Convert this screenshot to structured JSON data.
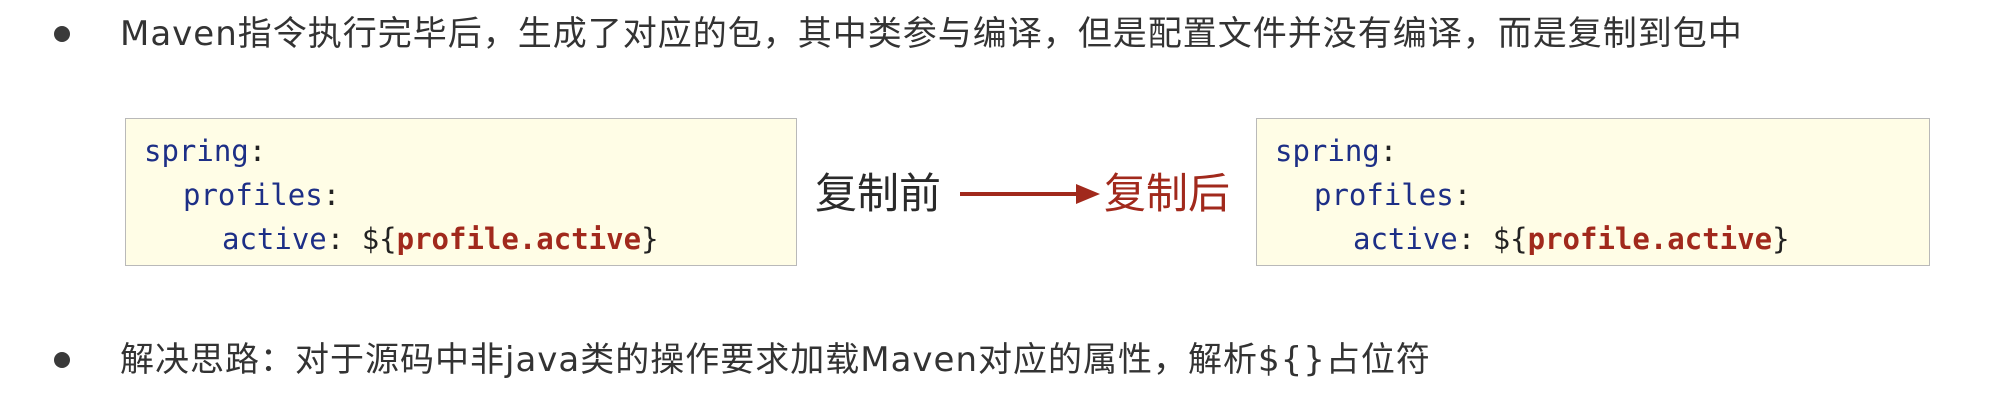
{
  "bullets": {
    "first": "Maven指令执行完毕后，生成了对应的包，其中类参与编译，但是配置文件并没有编译，而是复制到包中",
    "second": "解决思路：对于源码中非java类的操作要求加载Maven对应的属性，解析${}占位符"
  },
  "code_before": {
    "line1_key": "spring",
    "line2_key": "profiles",
    "line3_key": "active",
    "colon": ":",
    "placeholder_open": "${",
    "placeholder_name": "profile.active",
    "placeholder_close": "}"
  },
  "code_after": {
    "line1_key": "spring",
    "line2_key": "profiles",
    "line3_key": "active",
    "colon": ":",
    "placeholder_open": "${",
    "placeholder_name": "profile.active",
    "placeholder_close": "}"
  },
  "diagram": {
    "before_label": "复制前",
    "after_label": "复制后"
  },
  "colors": {
    "accent_red": "#a1291c",
    "keyword_blue": "#1d2f86",
    "code_bg": "#fffde6",
    "text": "#333333"
  },
  "icons": {
    "arrow": "arrow-right-icon",
    "bullet": "bullet-dot-icon"
  }
}
